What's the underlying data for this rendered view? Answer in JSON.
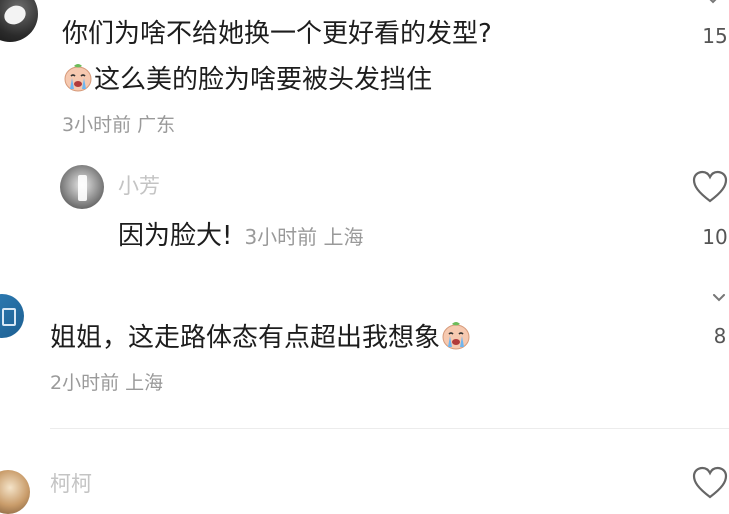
{
  "comments": [
    {
      "line1": "你们为啥不给她换一个更好看的发型?",
      "line2": "这么美的脸为啥要被头发挡住",
      "meta": "3小时前 广东",
      "likes": "15"
    },
    {
      "username": "小芳",
      "text": "因为脸大!",
      "meta": "3小时前 上海",
      "likes": "10"
    },
    {
      "text": "姐姐，这走路体态有点超出我想象",
      "meta": "2小时前 上海",
      "likes": "8"
    },
    {
      "username": "柯柯"
    }
  ],
  "icons": {
    "like": "heart-outline-icon",
    "emoji": "crying-face-emoji"
  },
  "colors": {
    "text": "#1d1d1d",
    "meta": "#9a9a9a",
    "username": "#c4c4c4",
    "icon": "#666666"
  }
}
